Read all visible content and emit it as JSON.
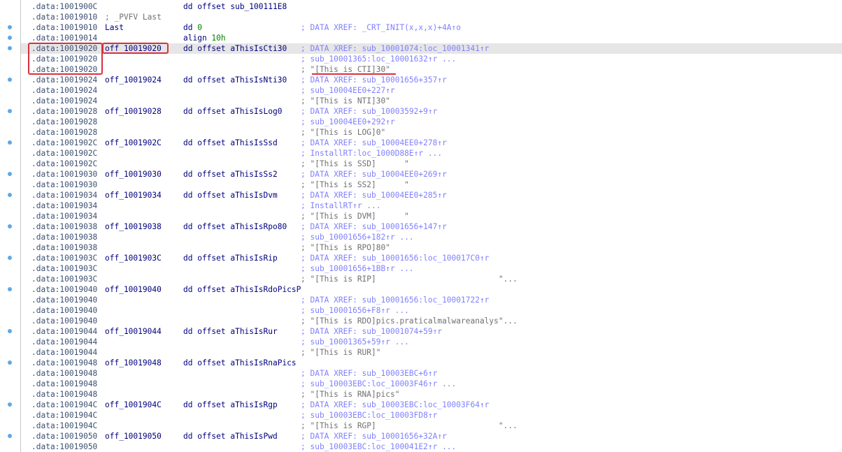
{
  "lines": [
    {
      "addr": ".data:1001900C",
      "label": "",
      "instr": "dd offset sub_100111E8",
      "comment": "",
      "dot": false
    },
    {
      "addr": ".data:10019010",
      "label": "; _PVFV Last",
      "instr": "",
      "comment": "",
      "dot": false
    },
    {
      "addr": ".data:10019010",
      "label": "Last",
      "instr": "dd 0",
      "comment": "; DATA XREF: _CRT_INIT(x,x,x)+4A↑o",
      "dot": true
    },
    {
      "addr": ".data:10019014",
      "label": "",
      "instr": "align 10h",
      "comment": "",
      "dot": true
    },
    {
      "addr": ".data:10019020",
      "label": "off_10019020",
      "instr": "dd offset aThisIsCti30",
      "comment": "; DATA XREF: sub_10001074:loc_10001341↑r",
      "dot": true,
      "highlight": true
    },
    {
      "addr": ".data:10019020",
      "label": "",
      "instr": "",
      "comment": "; sub_10001365:loc_10001632↑r ...",
      "dot": false
    },
    {
      "addr": ".data:10019020",
      "label": "",
      "instr": "",
      "comment": "; \"[This is CTI]30\"",
      "dot": false
    },
    {
      "addr": ".data:10019024",
      "label": "off_10019024",
      "instr": "dd offset aThisIsNti30",
      "comment": "; DATA XREF: sub_10001656+357↑r",
      "dot": true
    },
    {
      "addr": ".data:10019024",
      "label": "",
      "instr": "",
      "comment": "; sub_10004EE0+227↑r",
      "dot": false
    },
    {
      "addr": ".data:10019024",
      "label": "",
      "instr": "",
      "comment": "; \"[This is NTI]30\"",
      "dot": false
    },
    {
      "addr": ".data:10019028",
      "label": "off_10019028",
      "instr": "dd offset aThisIsLog0",
      "comment": "; DATA XREF: sub_10003592+9↑r",
      "dot": true
    },
    {
      "addr": ".data:10019028",
      "label": "",
      "instr": "",
      "comment": "; sub_10004EE0+292↑r",
      "dot": false
    },
    {
      "addr": ".data:10019028",
      "label": "",
      "instr": "",
      "comment": "; \"[This is LOG]0\"",
      "dot": false
    },
    {
      "addr": ".data:1001902C",
      "label": "off_1001902C",
      "instr": "dd offset aThisIsSsd",
      "comment": "; DATA XREF: sub_10004EE0+278↑r",
      "dot": true
    },
    {
      "addr": ".data:1001902C",
      "label": "",
      "instr": "",
      "comment": "; InstallRT:loc_1000D88E↑r ...",
      "dot": false
    },
    {
      "addr": ".data:1001902C",
      "label": "",
      "instr": "",
      "comment": "; \"[This is SSD]      \"",
      "dot": false
    },
    {
      "addr": ".data:10019030",
      "label": "off_10019030",
      "instr": "dd offset aThisIsSs2",
      "comment": "; DATA XREF: sub_10004EE0+269↑r",
      "dot": true
    },
    {
      "addr": ".data:10019030",
      "label": "",
      "instr": "",
      "comment": "; \"[This is SS2]      \"",
      "dot": false
    },
    {
      "addr": ".data:10019034",
      "label": "off_10019034",
      "instr": "dd offset aThisIsDvm",
      "comment": "; DATA XREF: sub_10004EE0+285↑r",
      "dot": true
    },
    {
      "addr": ".data:10019034",
      "label": "",
      "instr": "",
      "comment": "; InstallRT↑r ...",
      "dot": false
    },
    {
      "addr": ".data:10019034",
      "label": "",
      "instr": "",
      "comment": "; \"[This is DVM]      \"",
      "dot": false
    },
    {
      "addr": ".data:10019038",
      "label": "off_10019038",
      "instr": "dd offset aThisIsRpo80",
      "comment": "; DATA XREF: sub_10001656+147↑r",
      "dot": true
    },
    {
      "addr": ".data:10019038",
      "label": "",
      "instr": "",
      "comment": "; sub_10001656+182↑r ...",
      "dot": false
    },
    {
      "addr": ".data:10019038",
      "label": "",
      "instr": "",
      "comment": "; \"[This is RPO]80\"",
      "dot": false
    },
    {
      "addr": ".data:1001903C",
      "label": "off_1001903C",
      "instr": "dd offset aThisIsRip",
      "comment": "; DATA XREF: sub_10001656:loc_100017C0↑r",
      "dot": true
    },
    {
      "addr": ".data:1001903C",
      "label": "",
      "instr": "",
      "comment": "; sub_10001656+1BB↑r ...",
      "dot": false
    },
    {
      "addr": ".data:1001903C",
      "label": "",
      "instr": "",
      "comment": "; \"[This is RIP]                          \"...",
      "dot": false
    },
    {
      "addr": ".data:10019040",
      "label": "off_10019040",
      "instr": "dd offset aThisIsRdoPicsP",
      "comment": "",
      "dot": true
    },
    {
      "addr": ".data:10019040",
      "label": "",
      "instr": "",
      "comment": "; DATA XREF: sub_10001656:loc_10001722↑r",
      "dot": false
    },
    {
      "addr": ".data:10019040",
      "label": "",
      "instr": "",
      "comment": "; sub_10001656+F8↑r ...",
      "dot": false
    },
    {
      "addr": ".data:10019040",
      "label": "",
      "instr": "",
      "comment": "; \"[This is RDO]pics.praticalmalwareanalys\"...",
      "dot": false
    },
    {
      "addr": ".data:10019044",
      "label": "off_10019044",
      "instr": "dd offset aThisIsRur",
      "comment": "; DATA XREF: sub_10001074+59↑r",
      "dot": true
    },
    {
      "addr": ".data:10019044",
      "label": "",
      "instr": "",
      "comment": "; sub_10001365+59↑r ...",
      "dot": false
    },
    {
      "addr": ".data:10019044",
      "label": "",
      "instr": "",
      "comment": "; \"[This is RUR]\"",
      "dot": false
    },
    {
      "addr": ".data:10019048",
      "label": "off_10019048",
      "instr": "dd offset aThisIsRnaPics",
      "comment": "",
      "dot": true
    },
    {
      "addr": ".data:10019048",
      "label": "",
      "instr": "",
      "comment": "; DATA XREF: sub_10003EBC+6↑r",
      "dot": false
    },
    {
      "addr": ".data:10019048",
      "label": "",
      "instr": "",
      "comment": "; sub_10003EBC:loc_10003F46↑r ...",
      "dot": false
    },
    {
      "addr": ".data:10019048",
      "label": "",
      "instr": "",
      "comment": "; \"[This is RNA]pics\"",
      "dot": false
    },
    {
      "addr": ".data:1001904C",
      "label": "off_1001904C",
      "instr": "dd offset aThisIsRgp",
      "comment": "; DATA XREF: sub_10003EBC:loc_10003F64↑r",
      "dot": true
    },
    {
      "addr": ".data:1001904C",
      "label": "",
      "instr": "",
      "comment": "; sub_10003EBC:loc_10003FD8↑r",
      "dot": false
    },
    {
      "addr": ".data:1001904C",
      "label": "",
      "instr": "",
      "comment": "; \"[This is RGP]                          \"...",
      "dot": false
    },
    {
      "addr": ".data:10019050",
      "label": "off_10019050",
      "instr": "dd offset aThisIsPwd",
      "comment": "; DATA XREF: sub_10001656+32A↑r",
      "dot": true
    },
    {
      "addr": ".data:10019050",
      "label": "",
      "instr": "",
      "comment": "; sub_10003EBC:loc_100041E2↑r ...",
      "dot": false
    }
  ],
  "colors": {
    "address": "#3c4f73",
    "label": "#00007f",
    "comment": "#8080ff",
    "string": "#707070",
    "annotation": "#d9303b",
    "highlight": "#e6e6e6",
    "breakpoint_dot": "#5fa8e8"
  }
}
